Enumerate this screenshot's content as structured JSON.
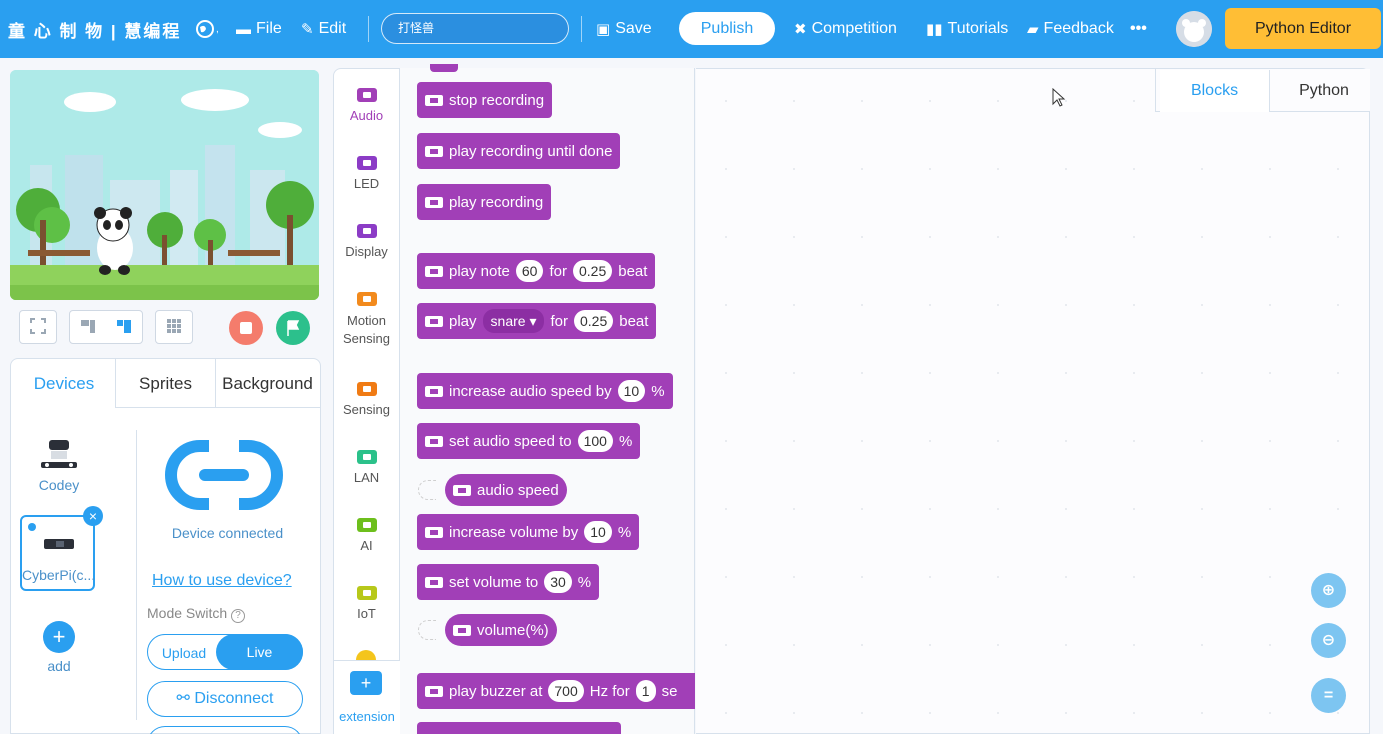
{
  "topbar": {
    "brand": "童 心 制 物 | 慧编程",
    "file_label": "File",
    "edit_label": "Edit",
    "project_name": "打怪兽",
    "save_label": "Save",
    "publish_label": "Publish",
    "competition_label": "Competition",
    "tutorials_label": "Tutorials",
    "feedback_label": "Feedback",
    "more_label": "•••",
    "python_editor_label": "Python Editor"
  },
  "stage_tabs": {
    "devices": "Devices",
    "sprites": "Sprites",
    "background": "Background"
  },
  "devices": {
    "codey_label": "Codey",
    "cyberpi_label": "CyberPi(c...",
    "add_label": "add",
    "status": "Device connected",
    "help_link": "How to use device?",
    "mode_switch_label": "Mode Switch",
    "mode_upload": "Upload",
    "mode_live": "Live",
    "disconnect_label": "Disconnect"
  },
  "categories": [
    {
      "label": "Audio",
      "color": "#a13fb7",
      "active": true
    },
    {
      "label": "LED",
      "color": "#8c3cc6"
    },
    {
      "label": "Display",
      "color": "#8c3cc6"
    },
    {
      "label": "Motion Sensing",
      "color": "#f28a1d"
    },
    {
      "label": "Sensing",
      "color": "#f07b14"
    },
    {
      "label": "LAN",
      "color": "#2bc18a"
    },
    {
      "label": "AI",
      "color": "#6dbf1c"
    },
    {
      "label": "IoT",
      "color": "#b7c81a"
    }
  ],
  "extension_label": "extension",
  "blocks": {
    "stop_recording": "stop recording",
    "play_until_done": "play recording until done",
    "play_recording": "play recording",
    "play_note_a": "play note",
    "play_note_val": "60",
    "play_note_b": "for",
    "play_note_beat": "0.25",
    "play_note_c": "beat",
    "play_drum_a": "play",
    "play_drum_val": "snare",
    "play_drum_b": "for",
    "play_drum_beat": "0.25",
    "play_drum_c": "beat",
    "inc_speed": "increase audio speed by",
    "inc_speed_val": "10",
    "pct": "%",
    "set_speed": "set audio speed to",
    "set_speed_val": "100",
    "audio_speed": "audio speed",
    "inc_vol": "increase volume by",
    "inc_vol_val": "10",
    "set_vol": "set volume to",
    "set_vol_val": "30",
    "volume": "volume(%)",
    "buzzer_a": "play buzzer at",
    "buzzer_val": "700",
    "buzzer_b": "Hz for",
    "buzzer_dur": "1",
    "buzzer_c": "se"
  },
  "editor_tabs": {
    "blocks": "Blocks",
    "python": "Python"
  },
  "colors": {
    "topbar": "#2a9ff0",
    "block_audio": "#a13fb7",
    "python_editor": "#ffbe35"
  }
}
